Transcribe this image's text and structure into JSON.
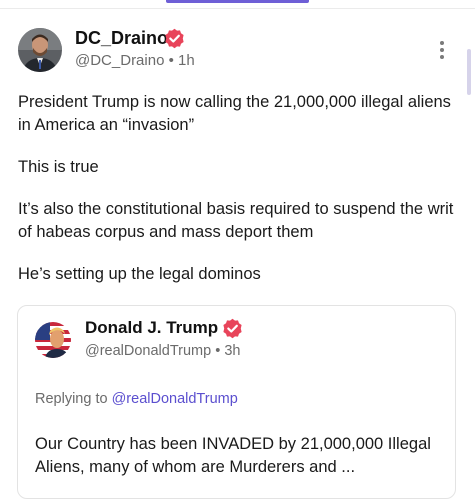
{
  "post": {
    "author": {
      "display_name": "DC_Draino",
      "handle": "@DC_Draino",
      "separator": "•",
      "time": "1h"
    },
    "paragraphs": [
      "President Trump is now calling the 21,000,000 illegal aliens in America an “invasion”",
      "This is true",
      "It’s also the constitutional basis required to suspend the writ of habeas corpus and mass deport them",
      "He’s setting up the legal dominos"
    ],
    "quoted": {
      "display_name": "Donald J. Trump",
      "handle": "@realDonaldTrump",
      "separator": "•",
      "time": "3h",
      "replying_prefix": "Replying to",
      "replying_to": "@realDonaldTrump",
      "text": "Our Country has been INVADED by 21,000,000 Illegal Aliens, many of whom are Murderers and ..."
    }
  },
  "colors": {
    "accent": "#6e5fd6",
    "verified_badge": "#e8445a",
    "mention": "#5b4fcf",
    "secondary_text": "#6b6b6b"
  },
  "icons": {
    "verified": "verified-badge-icon",
    "more": "more-vertical-icon"
  }
}
